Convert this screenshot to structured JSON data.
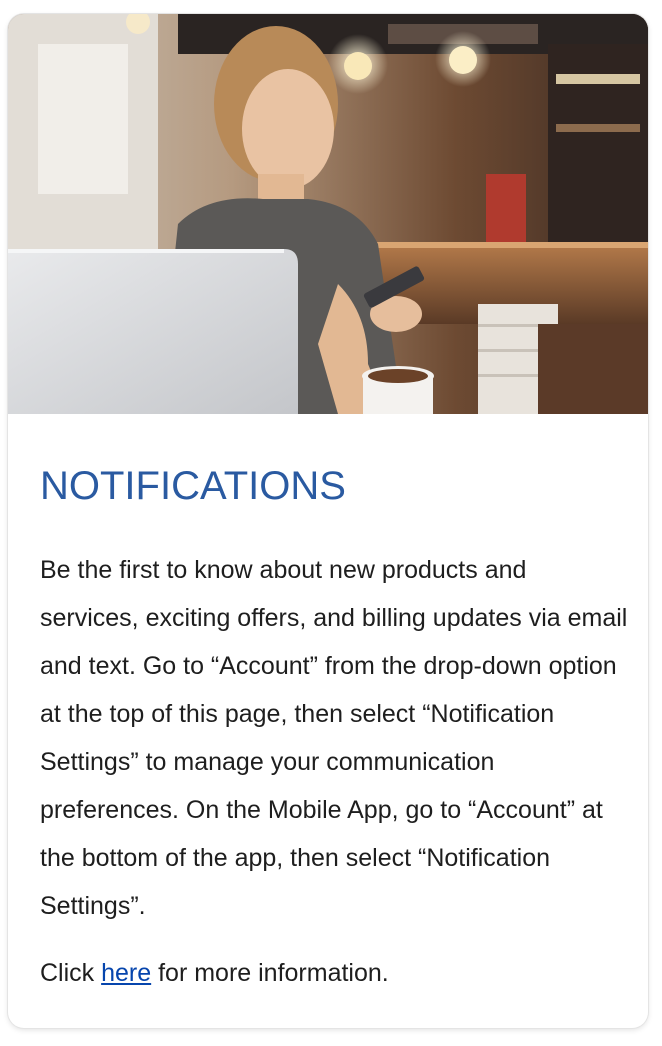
{
  "card": {
    "image_alt": "Woman in a cafe looking at her phone next to a laptop",
    "title": "NOTIFICATIONS",
    "body": "Be the first to know about new products and services, exciting offers, and billing updates via email and text. Go to “Account” from the drop-down option at the top of this page, then select “Notification Settings” to manage your communication preferences. On the Mobile App, go to “Account” at the bottom of the app, then select “Notification Settings”.",
    "more_prefix": "Click ",
    "more_link": "here",
    "more_suffix": " for more information."
  },
  "colors": {
    "title": "#2a5aa1",
    "link": "#0645ad",
    "text": "#1e1e1e"
  }
}
